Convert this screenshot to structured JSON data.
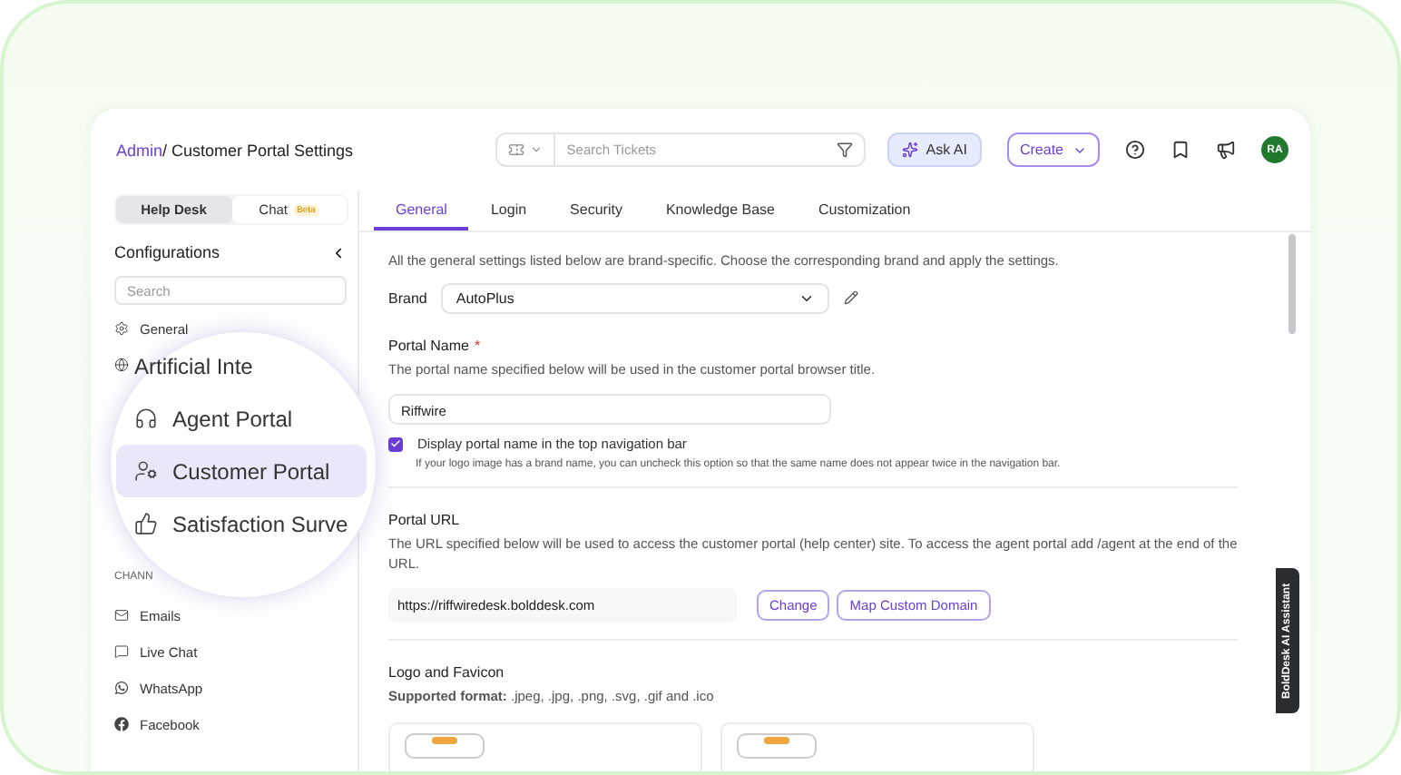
{
  "breadcrumb": {
    "root": "Admin",
    "current": "/ Customer Portal Settings"
  },
  "header": {
    "search_placeholder": "Search Tickets",
    "ask_ai": "Ask AI",
    "create": "Create",
    "avatar": "RA"
  },
  "sidebar": {
    "toggle": [
      {
        "label": "Help Desk",
        "selected": true
      },
      {
        "label": "Chat",
        "badge": "Beta",
        "selected": false
      }
    ],
    "title": "Configurations",
    "search_placeholder": "Search",
    "top_items": [
      {
        "kind": "gear",
        "label": "General"
      },
      {
        "kind": "globe"
      }
    ],
    "magnifier": [
      {
        "label": "Artificial Inte",
        "selected": false
      },
      {
        "kind": "headset",
        "label": "Agent Portal",
        "selected": false
      },
      {
        "kind": "userGear",
        "label": "Customer Portal",
        "selected": true
      },
      {
        "kind": "thumb",
        "label": "Satisfaction Surve",
        "selected": false
      }
    ],
    "section": "CHANN",
    "channels": [
      {
        "kind": "mail",
        "label": "Emails"
      },
      {
        "kind": "chat",
        "label": "Live Chat"
      },
      {
        "kind": "whatsapp",
        "label": "WhatsApp"
      },
      {
        "kind": "facebook",
        "label": "Facebook"
      }
    ]
  },
  "tabs": [
    {
      "label": "General",
      "selected": true
    },
    {
      "label": "Login",
      "selected": false
    },
    {
      "label": "Security",
      "selected": false
    },
    {
      "label": "Knowledge Base",
      "selected": false
    },
    {
      "label": "Customization",
      "selected": false
    }
  ],
  "intro": "All the general settings listed below are brand-specific. Choose the corresponding brand and apply the settings.",
  "brand": {
    "label": "Brand",
    "value": "AutoPlus"
  },
  "portal_name": {
    "title": "Portal Name",
    "required": "*",
    "description": "The portal name specified below will be used in the customer portal browser title.",
    "value": "Riffwire",
    "checkbox": {
      "label": "Display portal name in the top navigation bar",
      "checked": true
    },
    "hint": "If your logo image has a brand name, you can uncheck this option so that the same name does not appear twice in the navigation bar."
  },
  "portal_url": {
    "title": "Portal URL",
    "description": "The URL specified below will be used to access the customer portal (help center) site. To access the agent portal add /agent at the end of the URL.",
    "value": "https://riffwiredesk.bolddesk.com",
    "buttons": [
      "Change",
      "Map Custom Domain"
    ]
  },
  "logo": {
    "title": "Logo and Favicon",
    "formats": "**Supported format:** .jpeg, .jpg, .png, .svg, .gif and .ico"
  },
  "assistant_tab": "BoldDesk AI Assistant"
}
